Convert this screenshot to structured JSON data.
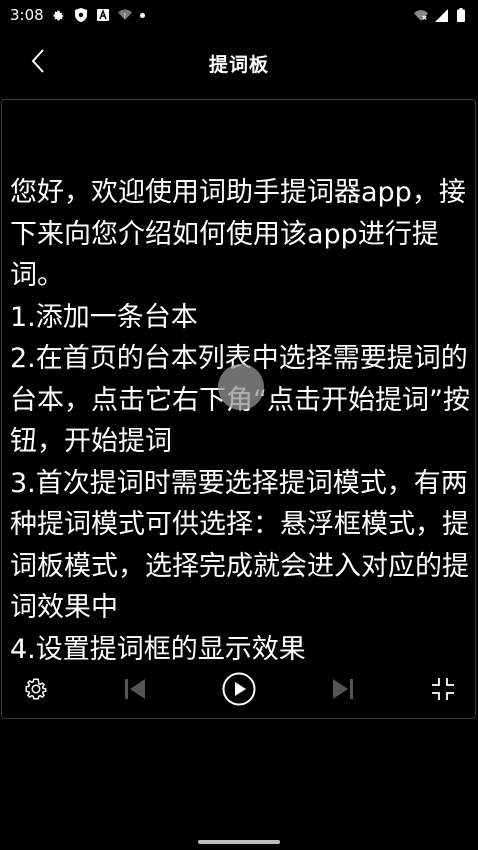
{
  "status_bar": {
    "time": "3:08",
    "icons_left": [
      "gear-icon",
      "shield-icon",
      "a-icon",
      "wifi-question-icon",
      "dot-icon"
    ],
    "icons_right": [
      "wifi-x-icon",
      "signal-icon",
      "battery-icon"
    ]
  },
  "app_bar": {
    "title": "提词板",
    "back_icon": "chevron-left-icon"
  },
  "teleprompter": {
    "text": "您好，欢迎使用词助手提词器app，接下来向您介绍如何使用该app进行提词。\n1.添加一条台本\n2.在首页的台本列表中选择需要提词的台本，点击它右下角“点击开始提词”按钮，开始提词\n3.首次提词时需要选择提词模式，有两种提词模式可供选择：悬浮框模式，提词板模式，选择完成就会进入对应的提词效果中\n4.设置提词框的显示效果"
  },
  "controls": {
    "icons": [
      "settings-icon",
      "previous-icon",
      "play-icon",
      "next-icon",
      "collapse-icon"
    ]
  },
  "colors": {
    "background": "#000000",
    "text": "#ffffff",
    "border": "#3a3a3a",
    "disabled_icon": "#555555"
  }
}
